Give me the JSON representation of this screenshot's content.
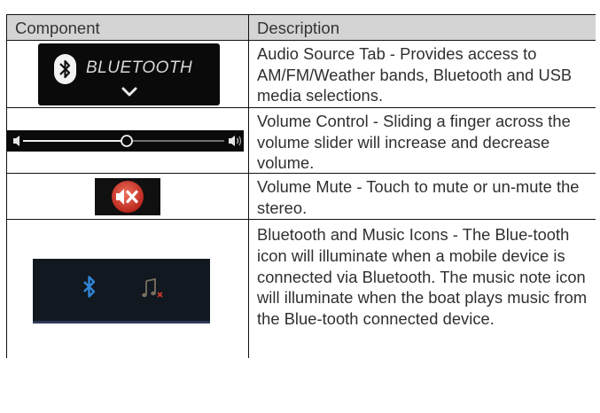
{
  "table": {
    "headers": {
      "component": "Component",
      "description": "Description"
    },
    "rows": [
      {
        "image_label": "BLUETOOTH",
        "icon": "bluetooth-tab-icon",
        "description": "Audio Source Tab - Provides access to AM/FM/Weather bands, Bluetooth and USB media selections."
      },
      {
        "icon": "volume-slider-icon",
        "slider_level": 0.52,
        "description": "Volume Control - Sliding a finger across the volume slider will increase and decrease volume."
      },
      {
        "icon": "volume-mute-icon",
        "description": "Volume Mute - Touch to mute or un-mute the stereo."
      },
      {
        "icon": "bluetooth-music-icons",
        "description": "Bluetooth and Music Icons - The Blue-tooth icon will illuminate when a mobile device is connected via Bluetooth.  The music note icon will illuminate when the boat plays music from the Blue-tooth connected device."
      }
    ]
  },
  "colors": {
    "header_bg": "#d4d4d4",
    "bluetooth_blue": "#2f86d9",
    "mute_red": "#c62d1f",
    "music_x_red": "#d23a2a"
  }
}
